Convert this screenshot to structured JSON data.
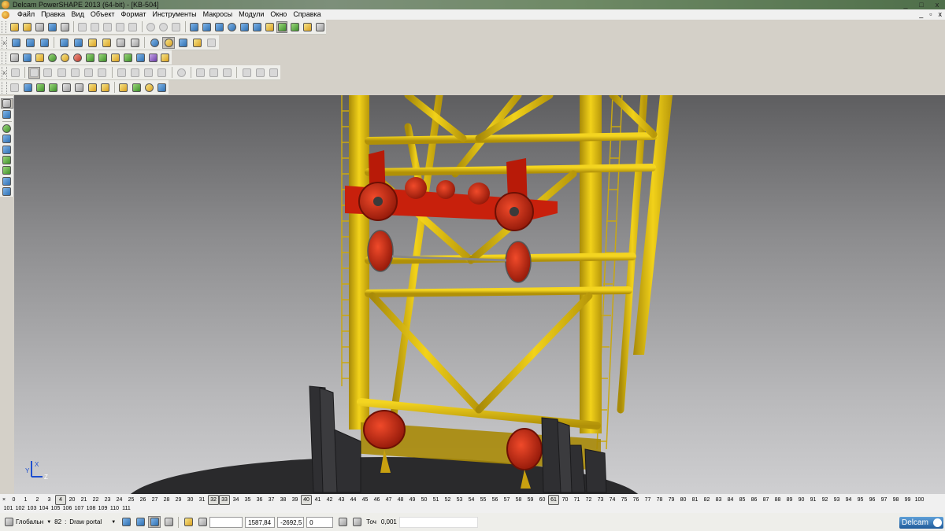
{
  "window": {
    "title": "Delcam PowerSHAPE 2013 (64-bit) - [KB-504]",
    "buttons": [
      "_",
      "□",
      "x"
    ]
  },
  "menu": {
    "items": [
      "Файл",
      "Правка",
      "Вид",
      "Объект",
      "Формат",
      "Инструменты",
      "Макросы",
      "Модули",
      "Окно",
      "Справка"
    ]
  },
  "viewport": {
    "model": "KB-504",
    "axis_labels": {
      "x": "X",
      "y": "Y",
      "z": "Z"
    },
    "colors": {
      "structure": "#e3bd12",
      "pulleys": "#c8200c",
      "base": "#2a2a2c",
      "background": "#8c8c8e"
    }
  },
  "levels": {
    "row1": [
      "0",
      "1",
      "2",
      "3",
      "4",
      "20",
      "21",
      "22",
      "23",
      "24",
      "25",
      "26",
      "27",
      "28",
      "29",
      "30",
      "31",
      "32",
      "33",
      "34",
      "35",
      "36",
      "37",
      "38",
      "39",
      "40",
      "41",
      "42",
      "43",
      "44",
      "45",
      "46",
      "47",
      "48",
      "49",
      "50",
      "51",
      "52",
      "53",
      "54",
      "55",
      "56",
      "57",
      "58",
      "59",
      "60",
      "61",
      "70",
      "71",
      "72",
      "73",
      "74",
      "75",
      "76",
      "77",
      "78",
      "79",
      "80",
      "81",
      "82",
      "83",
      "84",
      "85",
      "86",
      "87",
      "88",
      "89",
      "90",
      "91",
      "92",
      "93",
      "94",
      "95",
      "96",
      "97",
      "98",
      "99",
      "100"
    ],
    "row2": [
      "101",
      "102",
      "103",
      "104",
      "105",
      "106",
      "107",
      "108",
      "109",
      "110",
      "111"
    ],
    "active": [
      "4",
      "32",
      "33",
      "40",
      "61"
    ]
  },
  "status": {
    "workplane": "Глобальн",
    "level_num": "82",
    "level_name": "Draw portal",
    "coord_x": "1587,84",
    "coord_y": "-2692,5",
    "coord_z": "0",
    "tolerance_label": "Точ",
    "tolerance": "0,001",
    "brand": "Delcam"
  }
}
